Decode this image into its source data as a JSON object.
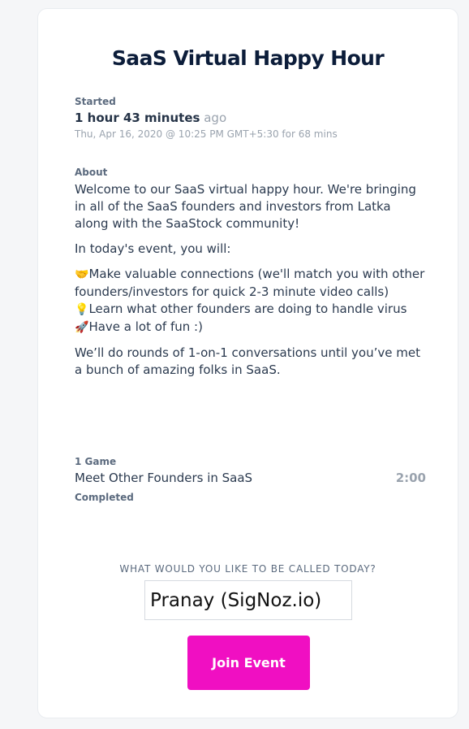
{
  "event": {
    "title": "SaaS Virtual Happy Hour"
  },
  "started": {
    "label": "Started",
    "duration": "1 hour 43 minutes",
    "ago": "ago",
    "datetime": "Thu, Apr 16, 2020 @ 10:25 PM GMT+5:30 for 68 mins"
  },
  "about": {
    "label": "About",
    "intro": "Welcome to our SaaS virtual happy hour. We're bringing in all of the SaaS founders and investors from Latka along with the SaaStock community!",
    "lead": "In today's event, you will:",
    "items": [
      {
        "emoji": "🤝",
        "text": "Make valuable connections (we'll match you with other founders/investors for quick 2-3 minute video calls)"
      },
      {
        "emoji": "💡",
        "text": "Learn what other founders are doing to handle virus"
      },
      {
        "emoji": "🚀",
        "text": "Have a lot of fun :)"
      }
    ],
    "closing": "We’ll do rounds of 1-on-1 conversations until you’ve met a bunch of amazing folks in SaaS."
  },
  "games": {
    "label": "1 Game",
    "items": [
      {
        "name": "Meet Other Founders in SaaS",
        "time": "2:00",
        "status": "Completed"
      }
    ]
  },
  "join": {
    "prompt": "What would you like to be called today?",
    "name_value": "Pranay (SigNoz.io)",
    "button_label": "Join Event"
  }
}
